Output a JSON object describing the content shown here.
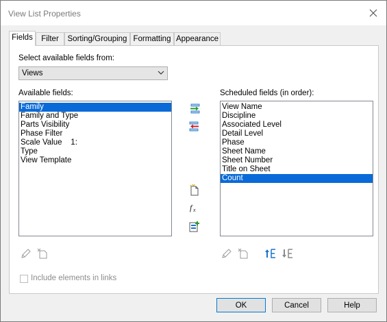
{
  "window": {
    "title": "View List Properties"
  },
  "tabs": [
    {
      "label": "Fields"
    },
    {
      "label": "Filter"
    },
    {
      "label": "Sorting/Grouping"
    },
    {
      "label": "Formatting"
    },
    {
      "label": "Appearance"
    }
  ],
  "fields_tab": {
    "select_from_label": "Select available fields from:",
    "select_from_value": "Views",
    "available_label": "Available fields:",
    "available_items": [
      "Family",
      "Family and Type",
      "Parts Visibility",
      "Phase Filter",
      "Scale Value    1:",
      "Type",
      "View Template"
    ],
    "available_selected_index": 0,
    "scheduled_label": "Scheduled fields (in order):",
    "scheduled_items": [
      "View Name",
      "Discipline",
      "Associated Level",
      "Detail Level",
      "Phase",
      "Sheet Name",
      "Sheet Number",
      "Title on Sheet",
      "Count"
    ],
    "scheduled_selected_index": 8,
    "include_links_label": "Include elements in links",
    "include_links_checked": false
  },
  "buttons": {
    "ok": "OK",
    "cancel": "Cancel",
    "help": "Help"
  },
  "colors": {
    "selection": "#0a6ad8",
    "accent_blue": "#1a73c9",
    "remove_red": "#d42020",
    "add_green": "#2b9b2b"
  },
  "icons": {
    "add": "add-field-icon",
    "remove": "remove-field-icon",
    "new_param": "new-parameter-icon",
    "fx": "calculated-value-icon",
    "combine": "combine-parameters-icon",
    "edit": "edit-pencil-icon",
    "delete": "delete-parameter-icon",
    "move_up": "move-up-icon",
    "move_down": "move-down-icon"
  }
}
